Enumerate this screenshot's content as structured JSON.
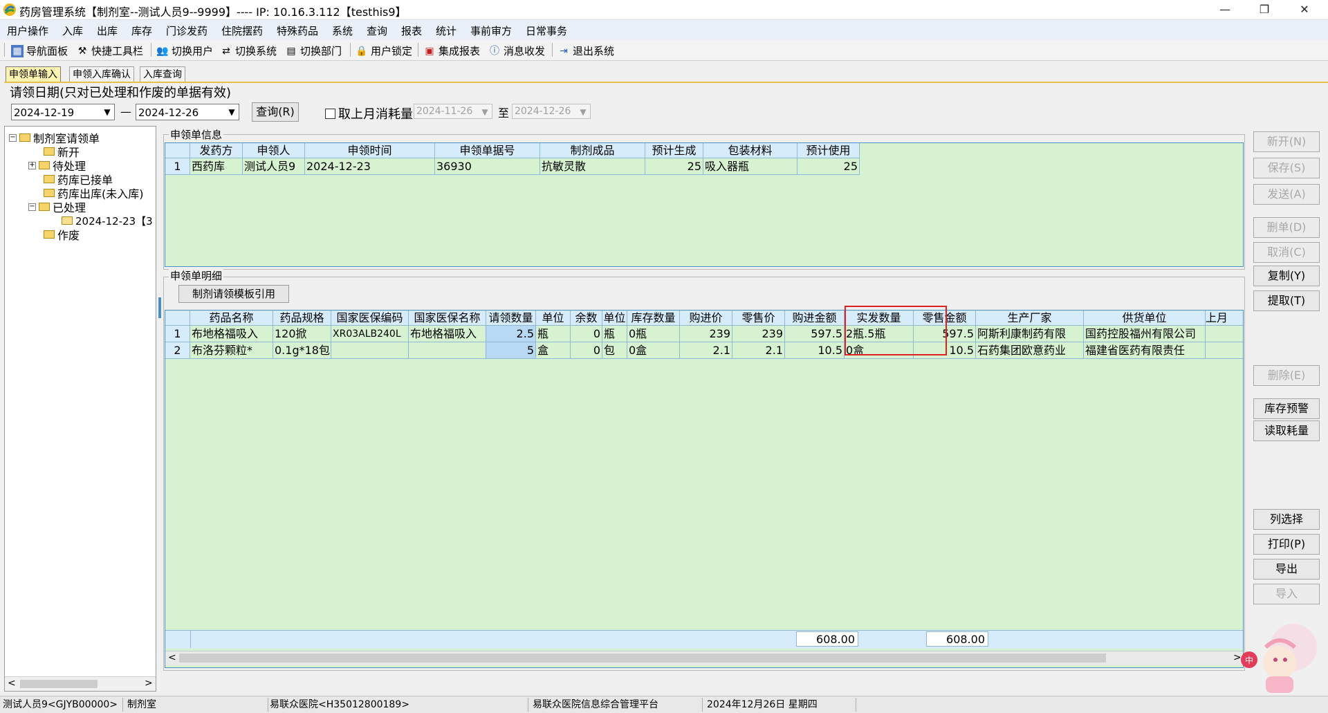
{
  "window": {
    "title": "药房管理系统【制剂室--测试人员9--9999】---- IP: 10.16.3.112【testhis9】",
    "minimize": "—",
    "restore": "❐",
    "close": "✕"
  },
  "menu": [
    "用户操作",
    "入库",
    "出库",
    "库存",
    "门诊发药",
    "住院摆药",
    "特殊药品",
    "系统",
    "查询",
    "报表",
    "统计",
    "事前审方",
    "日常事务"
  ],
  "toolbar": [
    "导航面板",
    "快捷工具栏",
    "切换用户",
    "切换系统",
    "切换部门",
    "用户锁定",
    "集成报表",
    "消息收发",
    "退出系统"
  ],
  "tabs": [
    "申领单输入",
    "申领入库确认",
    "入库查询"
  ],
  "filter": {
    "title": "请领日期(只对已处理和作废的单据有效)",
    "date_from": "2024-12-19",
    "dash": "—",
    "date_to": "2024-12-26",
    "query_label": "查询(R)",
    "checkbox_label": "取上月消耗量",
    "consume_from": "2024-11-26",
    "to_label": "至",
    "consume_to": "2024-12-26"
  },
  "tree": {
    "root": "制剂室请领单",
    "items": [
      "新开",
      "待处理",
      "药库已接单",
      "药库出库(未入库)",
      "已处理",
      "2024-12-23【3",
      "作废"
    ],
    "scroll_left": "<",
    "scroll_right": ">"
  },
  "header_grid": {
    "title": "申领单信息",
    "columns": [
      "发药方",
      "申领人",
      "申领时间",
      "申领单据号",
      "制剂成品",
      "预计生成",
      "包装材料",
      "预计使用"
    ],
    "rows": [
      [
        "1",
        "西药库",
        "测试人员9",
        "2024-12-23",
        "36930",
        "抗敏灵散",
        "25",
        "吸入器瓶",
        "25"
      ]
    ]
  },
  "detail_grid": {
    "title": "申领单明细",
    "template_button": "制剂请领模板引用",
    "columns": [
      "药品名称",
      "药品规格",
      "国家医保编码",
      "国家医保名称",
      "请领数量",
      "单位",
      "余数",
      "单位",
      "库存数量",
      "购进价",
      "零售价",
      "购进金额",
      "实发数量",
      "零售金额",
      "生产厂家",
      "供货单位",
      "上月"
    ],
    "rows": [
      [
        "1",
        "布地格福吸入",
        "120掀",
        "XR03ALB240L",
        "布地格福吸入",
        "2.5",
        "瓶",
        "0",
        "瓶",
        "0瓶",
        "239",
        "239",
        "597.5",
        "2瓶.5瓶",
        "597.5",
        "阿斯利康制药有限",
        "国药控股福州有限公司",
        ""
      ],
      [
        "2",
        "布洛芬颗粒*",
        "0.1g*18包",
        "",
        "",
        "5",
        "盒",
        "0",
        "包",
        "0盒",
        "2.1",
        "2.1",
        "10.5",
        "0盒",
        "10.5",
        "石药集团欧意药业",
        "福建省医药有限责任",
        ""
      ]
    ],
    "totals": {
      "purchase_amount": "608.00",
      "retail_amount": "608.00"
    }
  },
  "side_buttons": [
    {
      "label": "新开(N)",
      "enabled": false
    },
    {
      "label": "保存(S)",
      "enabled": false
    },
    {
      "label": "发送(A)",
      "enabled": false
    },
    {
      "label": "删单(D)",
      "enabled": false
    },
    {
      "label": "取消(C)",
      "enabled": false
    },
    {
      "label": "复制(Y)",
      "enabled": true
    },
    {
      "label": "提取(T)",
      "enabled": true
    },
    {
      "label": "删除(E)",
      "enabled": false
    },
    {
      "label": "库存预警",
      "enabled": true
    },
    {
      "label": "读取耗量",
      "enabled": true
    },
    {
      "label": "列选择",
      "enabled": true
    },
    {
      "label": "打印(P)",
      "enabled": true
    },
    {
      "label": "导出",
      "enabled": true
    },
    {
      "label": "导入",
      "enabled": false
    }
  ],
  "status": [
    "测试人员9<GJYB00000>",
    "制剂室",
    "易联众医院<H35012800189>",
    "易联众医院信息综合管理平台",
    "2024年12月26日 星期四"
  ]
}
